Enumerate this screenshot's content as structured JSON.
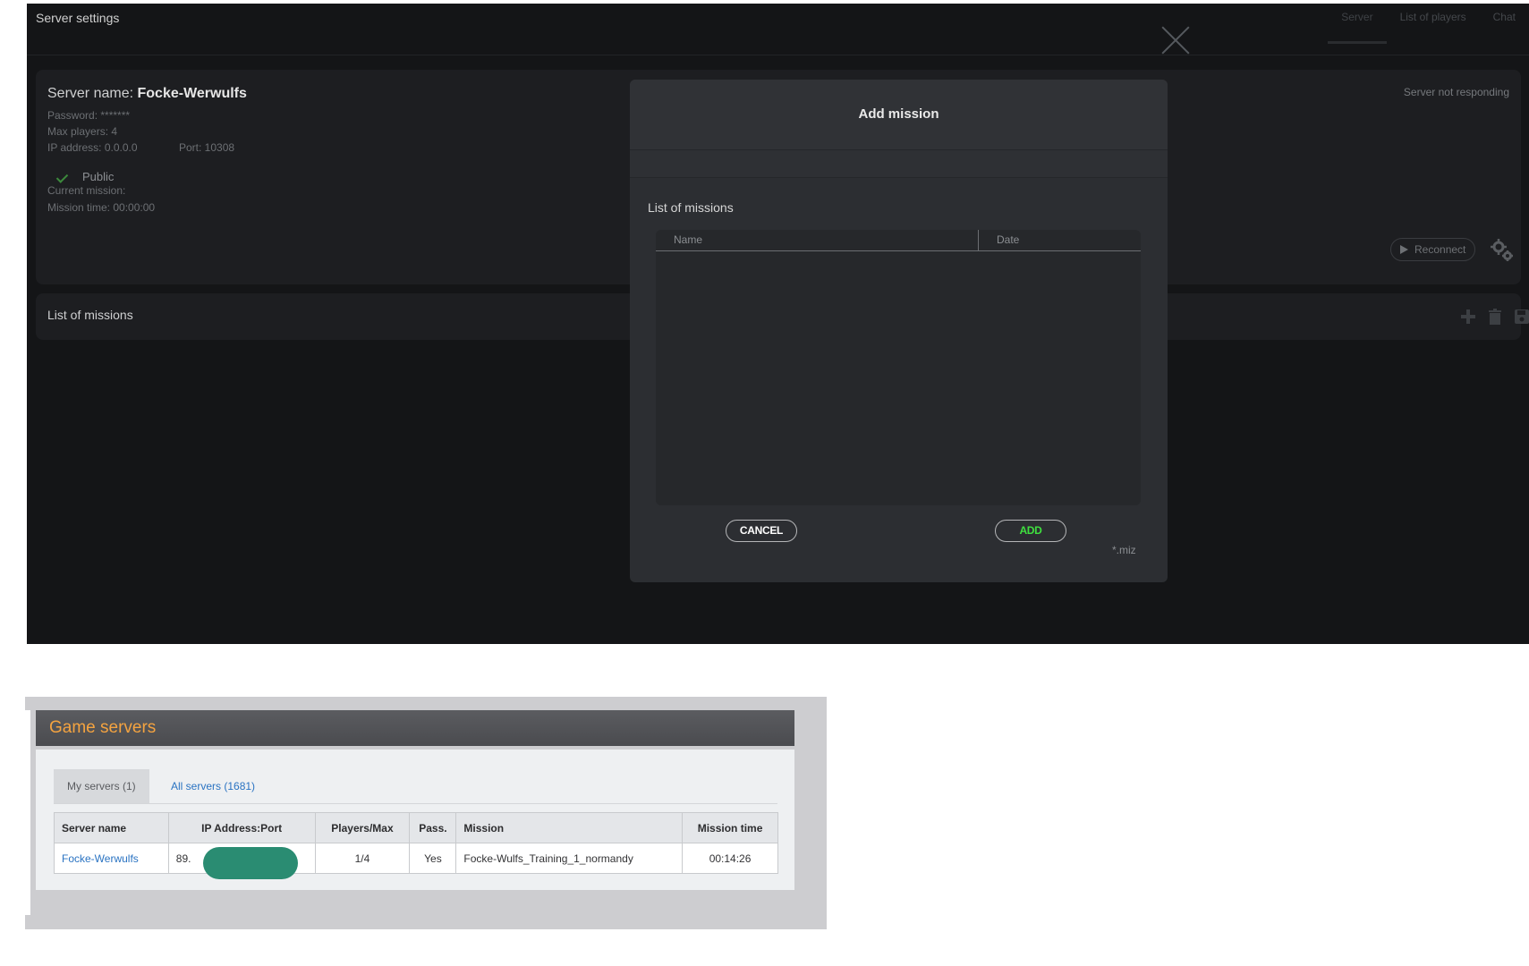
{
  "window": {
    "title": "Server settings",
    "tabs": [
      "Server",
      "List of players",
      "Chat"
    ]
  },
  "server": {
    "name_prefix": "Server name:",
    "name": "Focke-Werwulfs",
    "password": "Password: *******",
    "max_players": "Max players: 4",
    "ip": "IP address: 0.0.0.0",
    "port": "Port: 10308",
    "public_label": "Public",
    "current_mission": "Current mission:",
    "mission_time": "Mission time: 00:00:00",
    "status": "Server not responding",
    "reconnect_label": "Reconnect",
    "icons": [
      "play-icon",
      "gear-icon"
    ]
  },
  "missions_panel": {
    "title": "List of missions",
    "icons": [
      "plus-icon",
      "trash-icon",
      "save-icon"
    ]
  },
  "modal": {
    "title": "Add mission",
    "list_title": "List of missions",
    "columns": [
      "Name",
      "Date"
    ],
    "cancel_label": "CANCEL",
    "add_label": "ADD",
    "file_filter": "*.miz",
    "colors": {
      "add": "#3fe03f",
      "cancel": "#ffffff"
    }
  },
  "game_servers": {
    "title": "Game servers",
    "tabs": {
      "my": "My servers (1)",
      "all": "All servers (1681)"
    },
    "columns": [
      "Server name",
      "IP Address:Port",
      "Players/Max",
      "Pass.",
      "Mission",
      "Mission time"
    ],
    "rows": [
      {
        "server_name": "Focke-Werwulfs",
        "ip": "89.",
        "players": "1/4",
        "pass": "Yes",
        "mission": "Focke-Wulfs_Training_1_normandy",
        "mission_time": "00:14:26"
      }
    ],
    "colors": {
      "title": "#f4a340",
      "link": "#2a73c2",
      "redaction": "#2a8c72"
    }
  }
}
